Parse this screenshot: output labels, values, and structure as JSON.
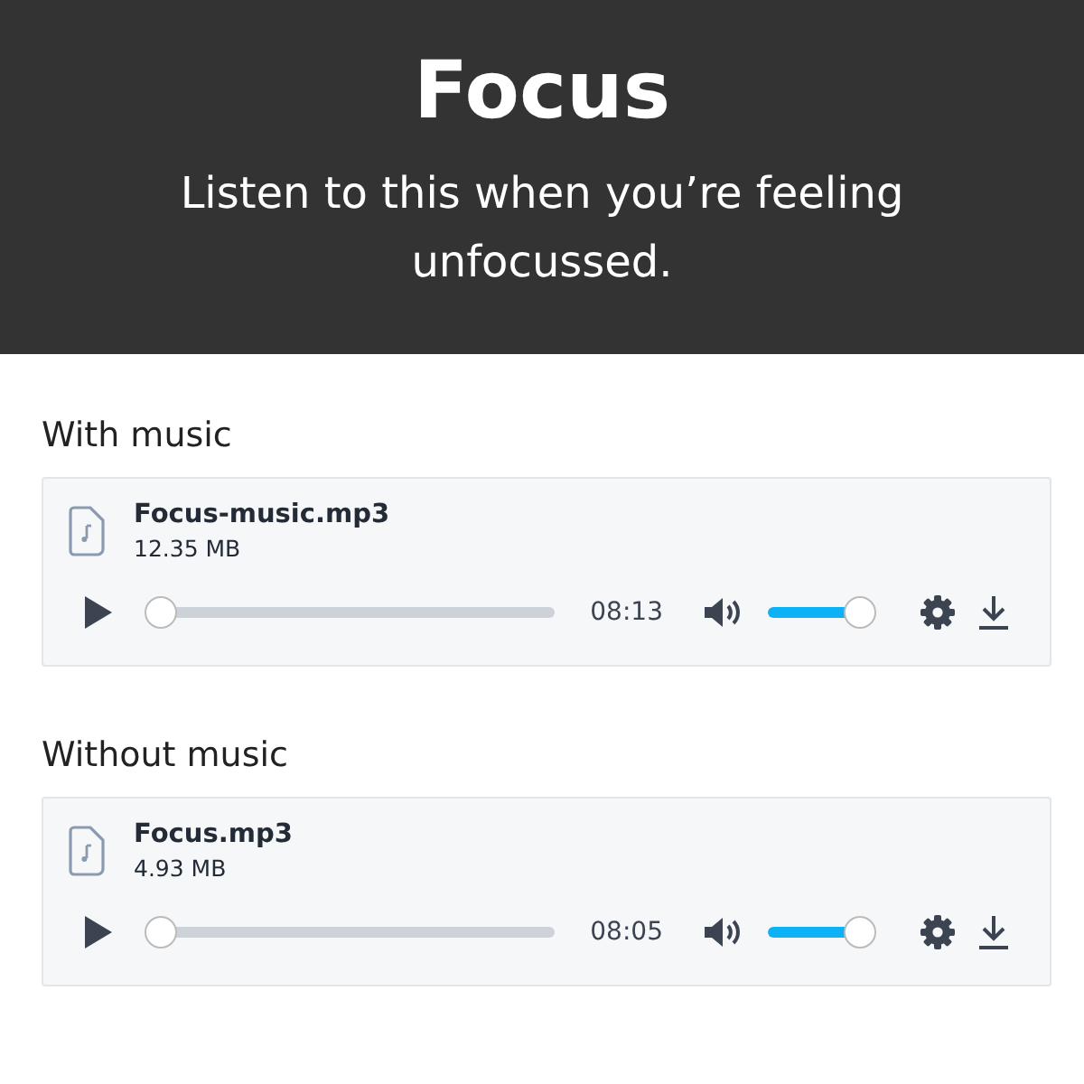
{
  "header": {
    "title": "Focus",
    "subtitle": "Listen to this when you’re feeling unfocussed."
  },
  "sections": [
    {
      "label": "With music",
      "player": {
        "file_name": "Focus-music.mp3",
        "file_size": "12.35 MB",
        "level": 0,
        "time": "08:13",
        "volume": {
          "level": 1
        }
      }
    },
    {
      "label": "Without music",
      "player": {
        "file_name": "Focus.mp3",
        "file_size": "4.93 MB",
        "level": 0,
        "time": "08:05",
        "volume": {
          "level": 1
        }
      }
    }
  ]
}
